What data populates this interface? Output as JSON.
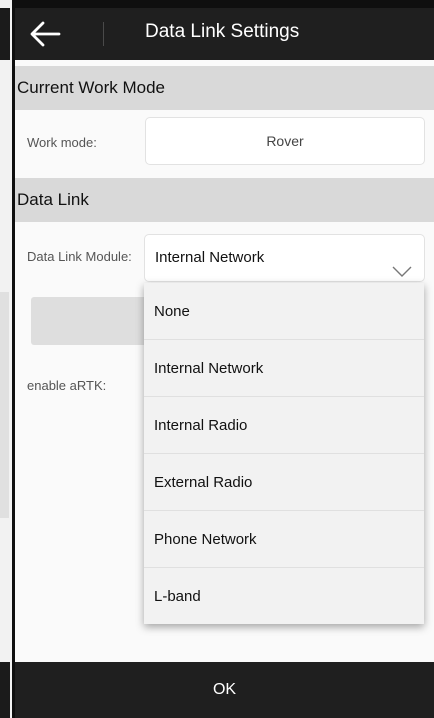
{
  "header": {
    "title": "Data Link Settings",
    "back_icon": "arrow-left-icon"
  },
  "sections": {
    "current_work_mode": "Current Work Mode",
    "data_link": "Data Link"
  },
  "work_mode": {
    "label": "Work mode:",
    "value": "Rover"
  },
  "data_link_module": {
    "label": "Data Link Module:",
    "selected": "Internal Network",
    "icon": "chevron-down-icon",
    "options": [
      "None",
      "Internal Network",
      "Internal Radio",
      "External Radio",
      "Phone Network",
      "L-band"
    ]
  },
  "artk": {
    "label": "enable aRTK:"
  },
  "footer": {
    "ok_label": "OK"
  },
  "colors": {
    "header_bg": "#1f1f1f",
    "section_bg": "#d9d9d9",
    "page_bg": "#fafafa"
  }
}
